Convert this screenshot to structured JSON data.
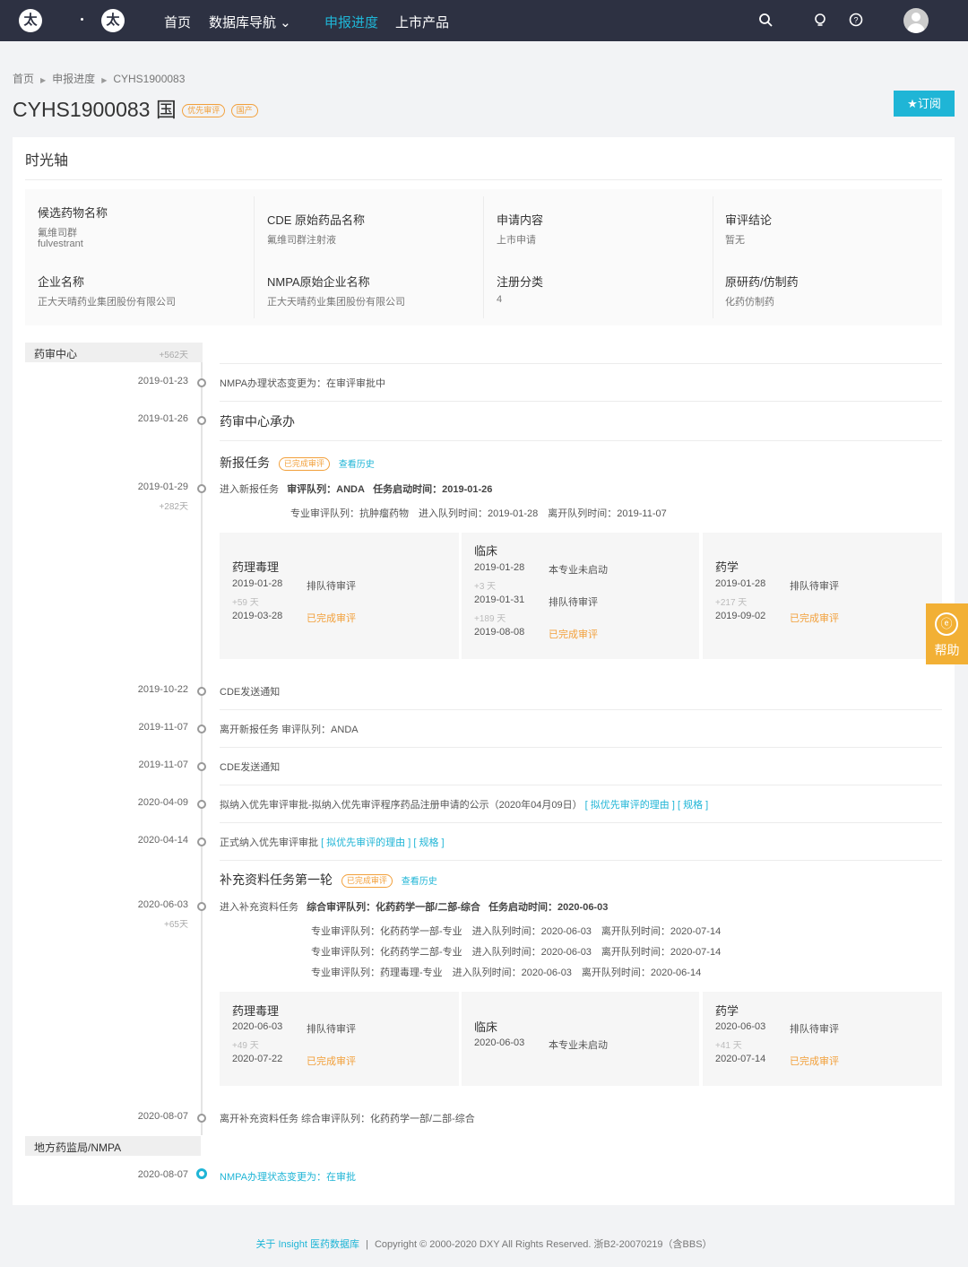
{
  "nav": {
    "logo_glyph": "太",
    "items": [
      "首页",
      "数据库导航 ⌄",
      "申报进度",
      "上市产品"
    ],
    "icons": [
      "search-icon",
      "bulb-icon",
      "question-icon",
      "user-avatar"
    ]
  },
  "breadcrumb": [
    "首页",
    "申报进度",
    "CYHS1900083"
  ],
  "title": {
    "code": "CYHS1900083",
    "mark": "国",
    "tags": [
      "优先审评",
      "国产"
    ]
  },
  "subscribe_label": "★订阅",
  "panel_title": "时光轴",
  "info": [
    {
      "label": "候选药物名称",
      "values": [
        "氟维司群",
        "fulvestrant"
      ]
    },
    {
      "label": "CDE 原始药品名称",
      "values": [
        "氟维司群注射液"
      ]
    },
    {
      "label": "申请内容",
      "values": [
        "上市申请"
      ]
    },
    {
      "label": "审评结论",
      "values": [
        "暂无"
      ]
    },
    {
      "label": "企业名称",
      "values": [
        "正大天晴药业集团股份有限公司"
      ]
    },
    {
      "label": "NMPA原始企业名称",
      "values": [
        "正大天晴药业集团股份有限公司"
      ]
    },
    {
      "label": "注册分类",
      "values": [
        "4"
      ]
    },
    {
      "label": "原研药/仿制药",
      "values": [
        "化药仿制药"
      ]
    }
  ],
  "groups": [
    {
      "label": "药审中心",
      "days": "+562天"
    },
    {
      "label": "地方药监局/NMPA",
      "days": ""
    }
  ],
  "events": {
    "e1": {
      "date": "2019-01-23",
      "text": "NMPA办理状态变更为：在审评审批中"
    },
    "e2": {
      "date": "2019-01-26",
      "text": "药审中心承办"
    },
    "task1": {
      "title": "新报任务",
      "tag": "已完成审评",
      "history": "查看历史",
      "date": "2019-01-29",
      "delta": "+282天",
      "line1_prefix": "进入新报任务",
      "line1_queue": "审评队列：ANDA",
      "line1_start": "任务启动时间：2019-01-26",
      "line2": "专业审评队列：抗肿瘤药物　进入队列时间：2019-01-28　离开队列时间：2019-11-07"
    },
    "e3": {
      "date": "2019-10-22",
      "text": "CDE发送通知"
    },
    "e4": {
      "date": "2019-11-07",
      "text": "离开新报任务  审评队列：ANDA"
    },
    "e5": {
      "date": "2019-11-07",
      "text": "CDE发送通知"
    },
    "e6": {
      "date": "2020-04-09",
      "text": "拟纳入优先审评审批-拟纳入优先审评程序药品注册申请的公示（2020年04月09日）",
      "links": "[ 拟优先审评的理由 ] [ 规格 ]"
    },
    "e7": {
      "date": "2020-04-14",
      "text": "正式纳入优先审评审批",
      "links": "[ 拟优先审评的理由 ] [ 规格 ]"
    },
    "task2": {
      "title": "补充资料任务第一轮",
      "tag": "已完成审评",
      "history": "查看历史",
      "date": "2020-06-03",
      "delta": "+65天",
      "line1_prefix": "进入补充资料任务",
      "line1_queue": "综合审评队列：化药药学一部/二部-综合",
      "line1_start": "任务启动时间：2020-06-03",
      "sub_lines": [
        "专业审评队列：化药药学一部-专业　进入队列时间：2020-06-03　离开队列时间：2020-07-14",
        "专业审评队列：化药药学二部-专业　进入队列时间：2020-06-03　离开队列时间：2020-07-14",
        "专业审评队列：药理毒理-专业　进入队列时间：2020-06-03　离开队列时间：2020-06-14"
      ]
    },
    "e8": {
      "date": "2020-08-07",
      "text": "离开补充资料任务  综合审评队列：化药药学一部/二部-综合"
    },
    "e9": {
      "date": "2020-08-07",
      "text": "NMPA办理状态变更为：在审批"
    }
  },
  "cards1": [
    {
      "title": "药理毒理",
      "rows": [
        {
          "date": "2019-01-28",
          "status": "排队待审评",
          "done": false,
          "delta": "+59 天"
        },
        {
          "date": "2019-03-28",
          "status": "已完成审评",
          "done": true,
          "delta": ""
        }
      ]
    },
    {
      "title": "临床",
      "rows": [
        {
          "date": "2019-01-28",
          "status": "本专业未启动",
          "done": false,
          "delta": "+3 天"
        },
        {
          "date": "2019-01-31",
          "status": "排队待审评",
          "done": false,
          "delta": "+189 天"
        },
        {
          "date": "2019-08-08",
          "status": "已完成审评",
          "done": true,
          "delta": ""
        }
      ]
    },
    {
      "title": "药学",
      "rows": [
        {
          "date": "2019-01-28",
          "status": "排队待审评",
          "done": false,
          "delta": "+217 天"
        },
        {
          "date": "2019-09-02",
          "status": "已完成审评",
          "done": true,
          "delta": ""
        }
      ]
    }
  ],
  "cards2": [
    {
      "title": "药理毒理",
      "rows": [
        {
          "date": "2020-06-03",
          "status": "排队待审评",
          "done": false,
          "delta": "+49 天"
        },
        {
          "date": "2020-07-22",
          "status": "已完成审评",
          "done": true,
          "delta": ""
        }
      ]
    },
    {
      "title": "临床",
      "rows": [
        {
          "date": "2020-06-03",
          "status": "本专业未启动",
          "done": false,
          "delta": ""
        }
      ]
    },
    {
      "title": "药学",
      "rows": [
        {
          "date": "2020-06-03",
          "status": "排队待审评",
          "done": false,
          "delta": "+41 天"
        },
        {
          "date": "2020-07-14",
          "status": "已完成审评",
          "done": true,
          "delta": ""
        }
      ]
    }
  ],
  "help_label": "帮助",
  "help_glyph": "ⓔ",
  "footer": {
    "link": "关于 Insight 医药数据库",
    "sep": "|",
    "text": "Copyright © 2000-2020 DXY All Rights Reserved. 浙B2-20070219（含BBS）"
  }
}
